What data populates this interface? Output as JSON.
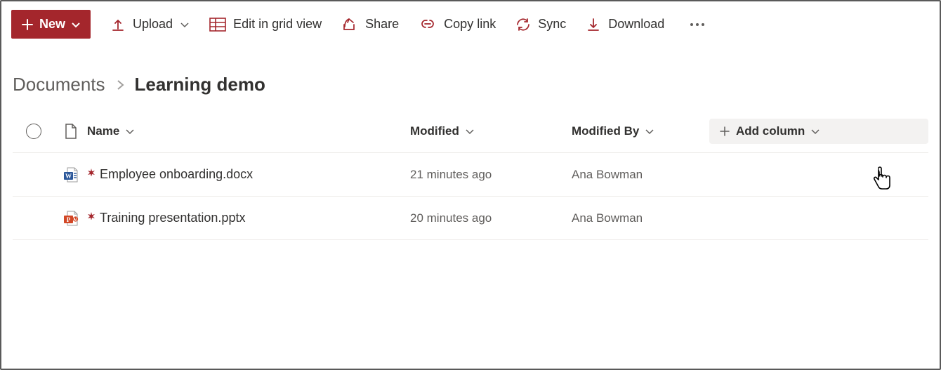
{
  "toolbar": {
    "new_label": "New",
    "upload_label": "Upload",
    "edit_grid_label": "Edit in grid view",
    "share_label": "Share",
    "copy_link_label": "Copy link",
    "sync_label": "Sync",
    "download_label": "Download"
  },
  "breadcrumb": {
    "parent": "Documents",
    "current": "Learning demo"
  },
  "columns": {
    "name_label": "Name",
    "modified_label": "Modified",
    "modified_by_label": "Modified By",
    "add_column_label": "Add column"
  },
  "files": [
    {
      "icon": "word",
      "name": "Employee onboarding.docx",
      "modified": "21 minutes ago",
      "modified_by": "Ana Bowman"
    },
    {
      "icon": "powerpoint",
      "name": "Training presentation.pptx",
      "modified": "20 minutes ago",
      "modified_by": "Ana Bowman"
    }
  ]
}
